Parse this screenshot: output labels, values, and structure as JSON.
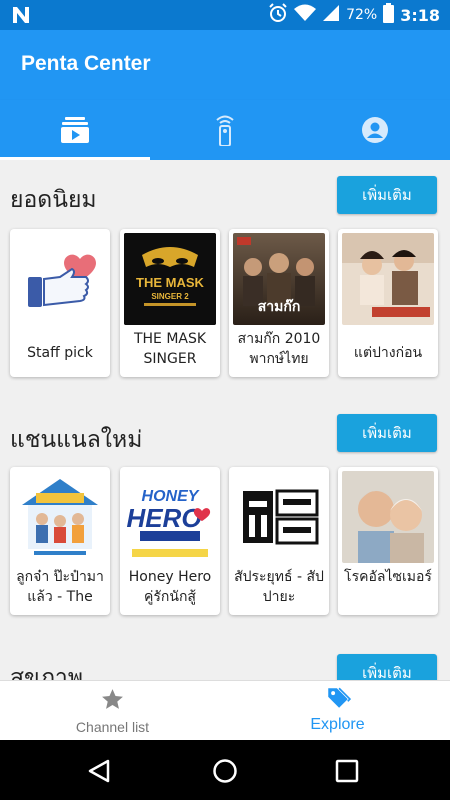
{
  "status_bar": {
    "battery": "72%",
    "time": "3:18",
    "icons": [
      "notification-n-icon",
      "alarm-icon",
      "wifi-icon",
      "signal-icon",
      "battery-icon"
    ]
  },
  "app_bar": {
    "title": "Penta Center"
  },
  "tabs": [
    {
      "icon": "video-library-icon",
      "selected": true
    },
    {
      "icon": "remote-control-icon",
      "selected": false
    },
    {
      "icon": "account-icon",
      "selected": false
    }
  ],
  "sections": [
    {
      "title": "ยอดนิยม",
      "more_label": "เพิ่มเติม",
      "cards": [
        {
          "label": "Staff pick",
          "thumb": "like-heart-icon"
        },
        {
          "label": "THE MASK SINGER",
          "thumb": "the-mask-singer-poster",
          "poster_text": "THE MASK SINGER 2"
        },
        {
          "label": "สามก๊ก 2010 พากษ์ไทย",
          "thumb": "three-kingdoms-poster",
          "poster_text": "สามก๊ก"
        },
        {
          "label": "แต่ปางก่อน",
          "thumb": "drama-poster"
        }
      ]
    },
    {
      "title": "แชนแนลใหม่",
      "more_label": "เพิ่มเติม",
      "cards": [
        {
          "label": "ลูกจ๋า ป๊ะป๋ามาแล้ว - The",
          "thumb": "family-show-poster"
        },
        {
          "label": "Honey Hero คู่รักนักสู้",
          "thumb": "honey-hero-poster",
          "poster_text": "HONEY HERO"
        },
        {
          "label": "สัประยุทธ์ - สัปปายะ",
          "thumb": "sappraiyut-logo",
          "poster_text": "สัป ระยุทธ์ ปายะ"
        },
        {
          "label": "โรคอัลไซเมอร์",
          "thumb": "elderly-couple-photo"
        }
      ]
    },
    {
      "title": "สุขภาพ",
      "more_label": "เพิ่มเติม",
      "cards": []
    }
  ],
  "bottom_nav": [
    {
      "label": "Channel list",
      "icon": "star-icon",
      "active": false
    },
    {
      "label": "Explore",
      "icon": "tag-icon",
      "active": true
    }
  ],
  "colors": {
    "primary": "#2196f3",
    "status_bar": "#0b79cf",
    "button": "#1aa2dd",
    "background": "#f0f0f0"
  }
}
